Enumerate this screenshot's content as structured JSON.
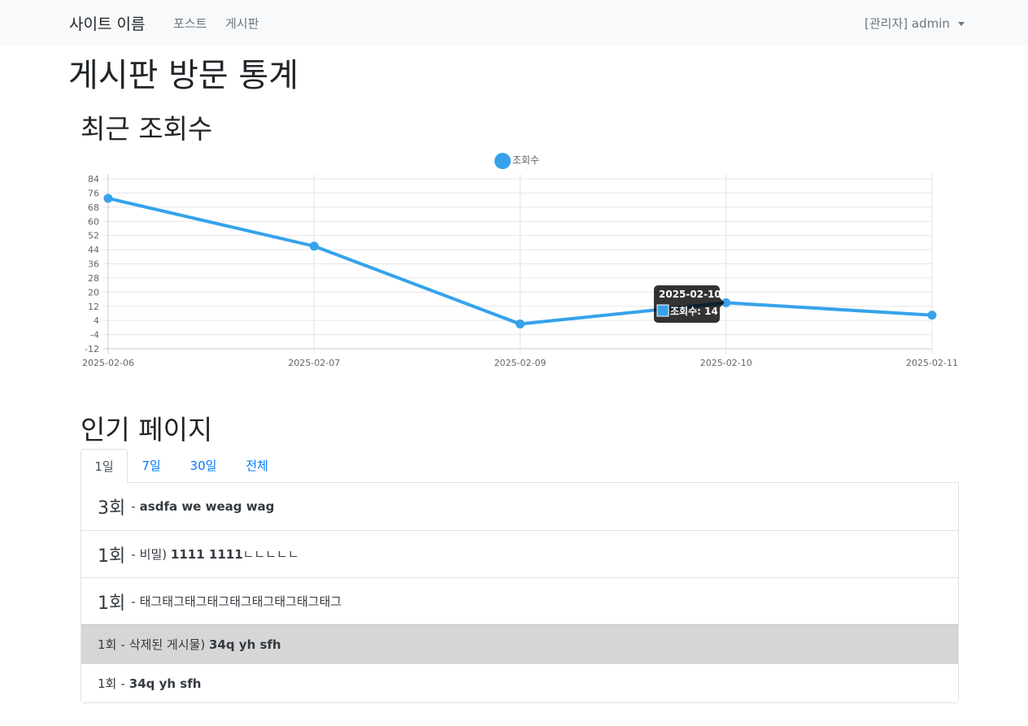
{
  "navbar": {
    "brand": "사이트 이름",
    "links": [
      "포스트",
      "게시판"
    ],
    "user": "[관리자] admin"
  },
  "page_title": "게시판 방문 통계",
  "recent_section": {
    "title": "최근 조회수"
  },
  "chart_data": {
    "type": "line",
    "x": [
      "2025-02-06",
      "2025-02-07",
      "2025-02-09",
      "2025-02-10",
      "2025-02-11"
    ],
    "series": [
      {
        "name": "조회수",
        "values": [
          73,
          46,
          2,
          14,
          7
        ],
        "color": "#36a2eb"
      }
    ],
    "ylim": [
      -12,
      84
    ],
    "yticks": [
      84,
      76,
      68,
      60,
      52,
      44,
      36,
      28,
      20,
      12,
      4,
      -4,
      -12
    ],
    "grid": true,
    "legend": "top",
    "tooltip": {
      "title": "2025-02-10",
      "label": "조회수: 14"
    }
  },
  "popular_section": {
    "title": "인기 페이지",
    "tabs": [
      "1일",
      "7일",
      "30일",
      "전체"
    ],
    "active_tab": 0,
    "items": [
      {
        "count": "3회",
        "sep": "-",
        "prefix": "",
        "title": "asdfa we weag wag",
        "suffix": "",
        "size": "big",
        "muted": false
      },
      {
        "count": "1회",
        "sep": "-",
        "prefix": "비밀) ",
        "title": "1111 1111",
        "suffix": "ㄴㄴㄴㄴㄴ",
        "size": "big",
        "muted": false
      },
      {
        "count": "1회",
        "sep": "-",
        "prefix": "",
        "title": "",
        "suffix": "태그태그태그태그태그태그태그태그태그",
        "size": "big",
        "muted": false
      },
      {
        "count": "1회",
        "sep": "-",
        "prefix": "삭제된 게시물) ",
        "title": "34q yh sfh",
        "suffix": "",
        "size": "small",
        "muted": true
      },
      {
        "count": "1회",
        "sep": "-",
        "prefix": "",
        "title": "34q yh sfh",
        "suffix": "",
        "size": "small",
        "muted": false
      }
    ]
  }
}
